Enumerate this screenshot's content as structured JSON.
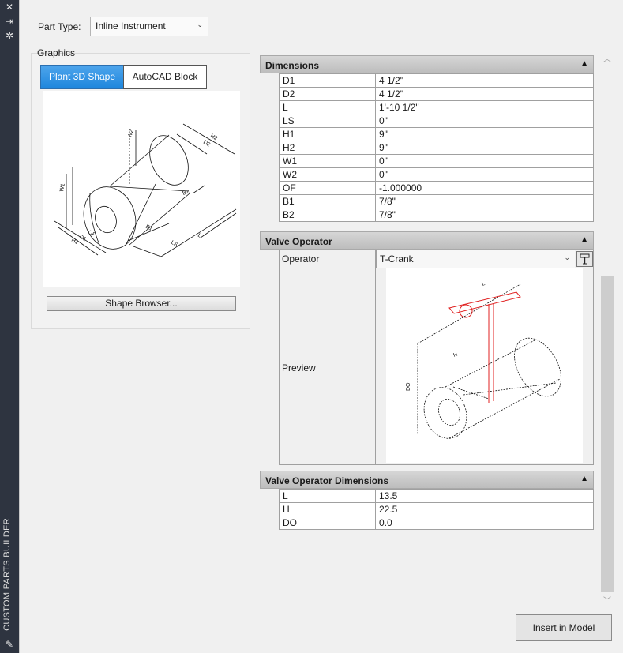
{
  "sidebar": {
    "title": "CUSTOM PARTS BUILDER"
  },
  "part_type": {
    "label": "Part Type:",
    "value": "Inline Instrument"
  },
  "graphics": {
    "label": "Graphics",
    "tabs": [
      {
        "label": "Plant 3D Shape",
        "active": true
      },
      {
        "label": "AutoCAD Block",
        "active": false
      }
    ],
    "shape_browser_label": "Shape Browser...",
    "drawing_labels": {
      "h2": "H2",
      "d2": "D2",
      "w2": "W2",
      "w1": "W1",
      "d1": "D1",
      "h1": "H1",
      "of": "OF",
      "b1": "B1",
      "b2": "B2",
      "ls": "LS",
      "l": "L"
    }
  },
  "dimensions": {
    "title": "Dimensions",
    "rows": [
      {
        "key": "D1",
        "value": "4 1/2\""
      },
      {
        "key": "D2",
        "value": "4 1/2\""
      },
      {
        "key": "L",
        "value": "1'-10 1/2\""
      },
      {
        "key": "LS",
        "value": "0\""
      },
      {
        "key": "H1",
        "value": "9\""
      },
      {
        "key": "H2",
        "value": "9\""
      },
      {
        "key": "W1",
        "value": "0\""
      },
      {
        "key": "W2",
        "value": "0\""
      },
      {
        "key": "OF",
        "value": "-1.000000"
      },
      {
        "key": "B1",
        "value": "7/8\""
      },
      {
        "key": "B2",
        "value": "7/8\""
      }
    ]
  },
  "valve_operator": {
    "title": "Valve Operator",
    "operator_label": "Operator",
    "operator_value": "T-Crank",
    "preview_label": "Preview",
    "drawing_labels": {
      "l": "L",
      "h": "H",
      "do": "DO"
    }
  },
  "valve_operator_dimensions": {
    "title": "Valve Operator Dimensions",
    "rows": [
      {
        "key": "L",
        "value": "13.5"
      },
      {
        "key": "H",
        "value": "22.5"
      },
      {
        "key": "DO",
        "value": "0.0"
      }
    ]
  },
  "insert_button_label": "Insert in Model",
  "colors": {
    "active_tab": "#1e86dd",
    "strip": "#2e3440",
    "operator_highlight": "#e02020"
  },
  "icons": {
    "strip": [
      "close-icon",
      "pin-icon",
      "settings-icon",
      "parts-builder-icon"
    ],
    "section_collapse": "chevron-up-icon",
    "operator_button": "wrench-icon"
  }
}
